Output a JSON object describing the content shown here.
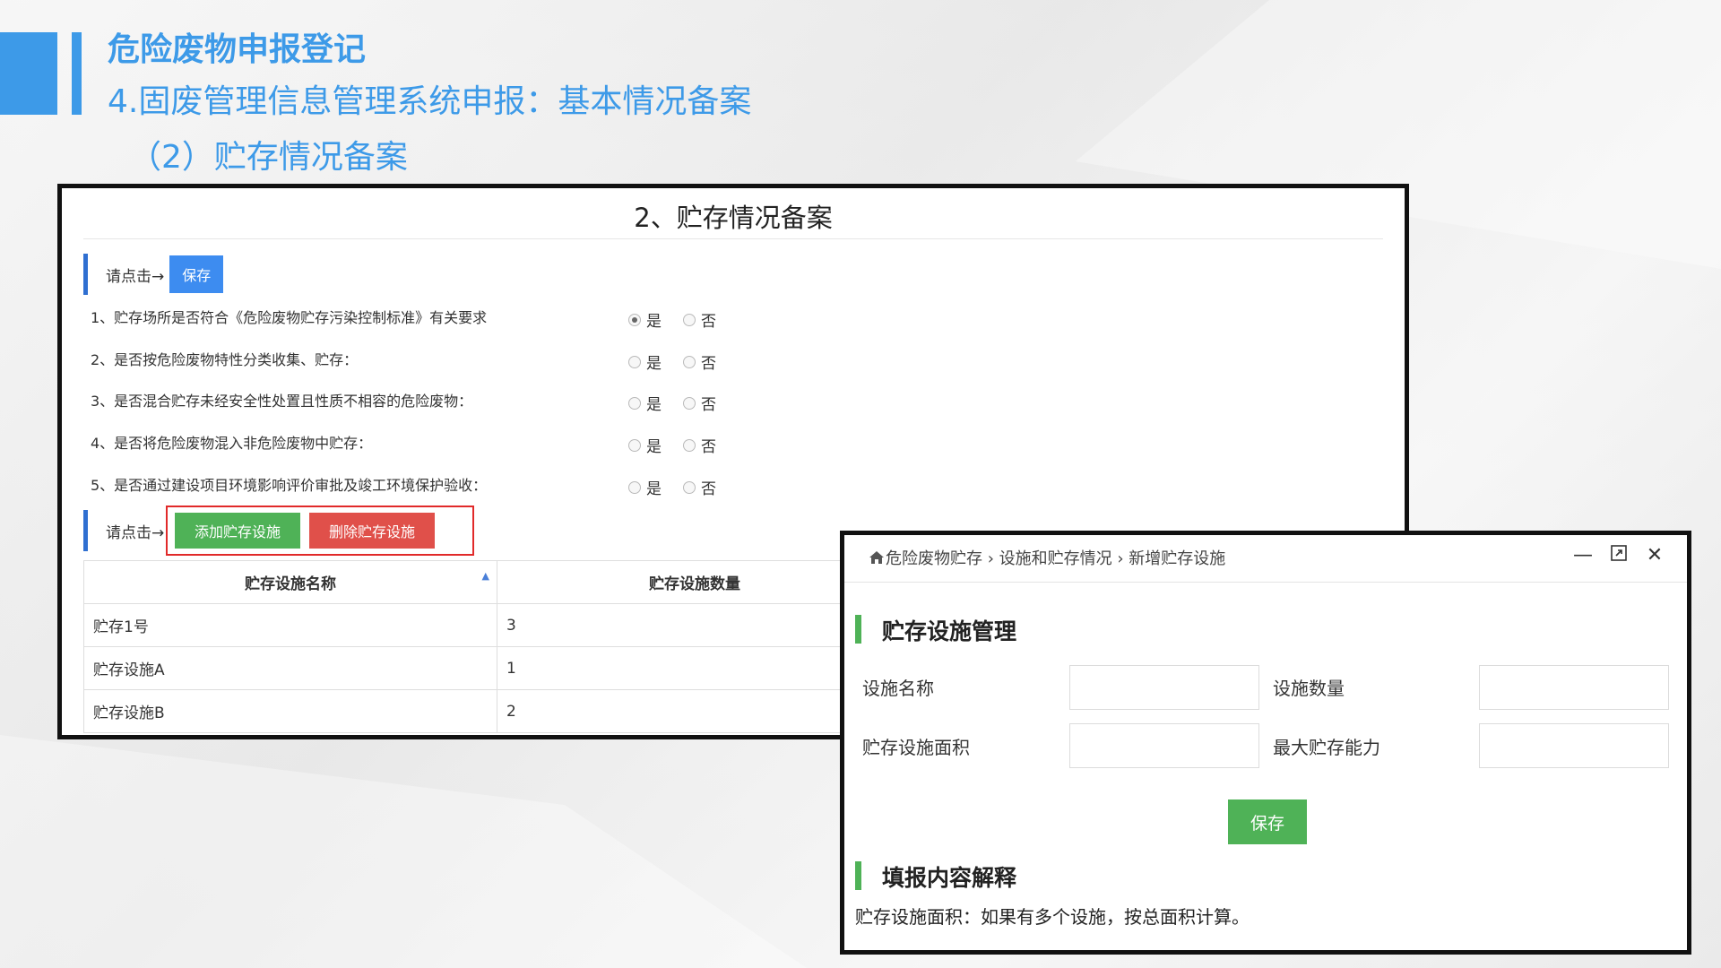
{
  "slide": {
    "title": "危险废物申报登记",
    "subtitle": "4.固废管理信息管理系统申报：基本情况备案",
    "section": "（2）贮存情况备案"
  },
  "panel": {
    "title": "2、贮存情况备案",
    "click_label": "请点击→",
    "save_label": "保存",
    "questions": [
      {
        "text": "1、贮存场所是否符合《危险废物贮存污染控制标准》有关要求",
        "selected": "是"
      },
      {
        "text": "2、是否按危险废物特性分类收集、贮存：",
        "selected": ""
      },
      {
        "text": "3、是否混合贮存未经安全性处置且性质不相容的危险废物：",
        "selected": ""
      },
      {
        "text": "4、是否将危险废物混入非危险废物中贮存：",
        "selected": ""
      },
      {
        "text": "5、是否通过建设项目环境影响评价审批及竣工环境保护验收：",
        "selected": ""
      }
    ],
    "option_yes": "是",
    "option_no": "否",
    "click_label2": "请点击→",
    "add_label": "添加贮存设施",
    "delete_label": "删除贮存设施",
    "table": {
      "headers": [
        "贮存设施名称",
        "贮存设施数量"
      ],
      "rows": [
        [
          "贮存1号",
          "3"
        ],
        [
          "贮存设施A",
          "1"
        ],
        [
          "贮存设施B",
          "2"
        ]
      ]
    }
  },
  "dialog": {
    "breadcrumb": "危险废物贮存 › 设施和贮存情况 › 新增贮存设施",
    "section1_title": "贮存设施管理",
    "fields": {
      "name_label": "设施名称",
      "count_label": "设施数量",
      "area_label": "贮存设施面积",
      "capacity_label": "最大贮存能力"
    },
    "save_label": "保存",
    "section2_title": "填报内容解释",
    "explain_text": "贮存设施面积：如果有多个设施，按总面积计算。"
  },
  "colors": {
    "accent_blue": "#3d9ae8",
    "save_blue": "#3d8cf0",
    "green": "#4fb257",
    "red": "#e0504a"
  }
}
